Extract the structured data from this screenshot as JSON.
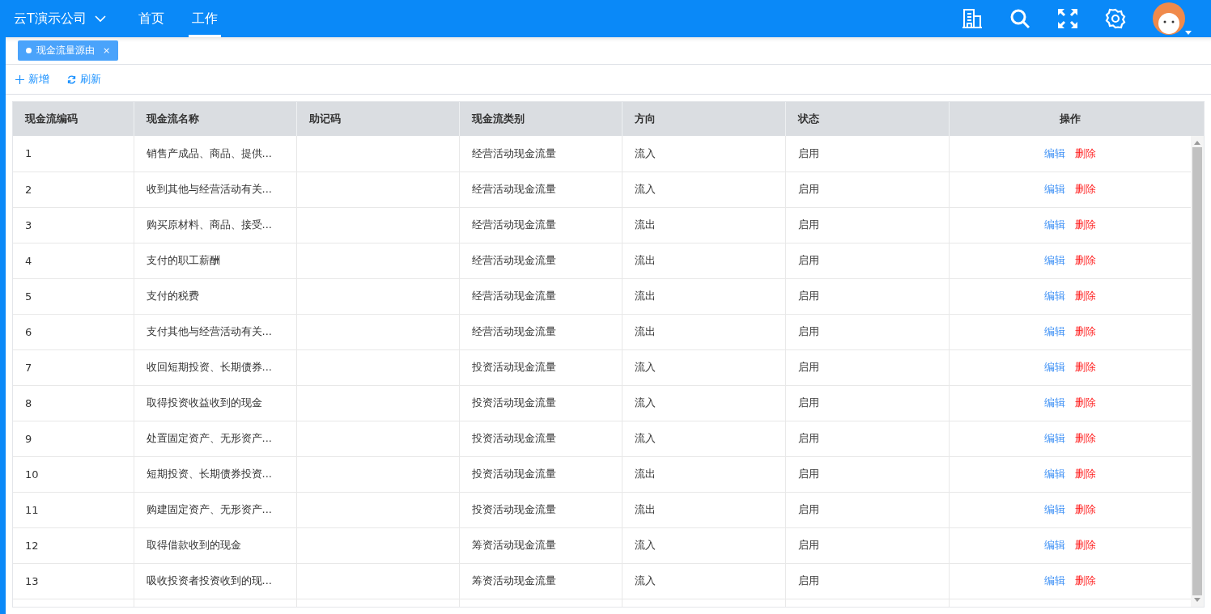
{
  "header": {
    "company": "云T演示公司",
    "nav": [
      {
        "label": "首页",
        "selected": false
      },
      {
        "label": "工作",
        "selected": true
      }
    ]
  },
  "page_tabs": [
    {
      "label": "现金流量源由",
      "selected": true,
      "close": "×"
    }
  ],
  "toolbar": [
    {
      "kind": "add",
      "label": "新增"
    },
    {
      "kind": "refresh",
      "label": "刷新"
    }
  ],
  "table": {
    "columns": [
      "现金流编码",
      "现金流名称",
      "助记码",
      "现金流类别",
      "方向",
      "状态",
      "操作"
    ],
    "rows": [
      {
        "code": "1",
        "name": "销售产成品、商品、提供...",
        "mnemonic": "",
        "category": "经营活动现金流量",
        "direction": "流入",
        "status": "启用",
        "actions": [
          "编辑",
          "删除"
        ]
      },
      {
        "code": "2",
        "name": "收到其他与经营活动有关...",
        "mnemonic": "",
        "category": "经营活动现金流量",
        "direction": "流入",
        "status": "启用",
        "actions": [
          "编辑",
          "删除"
        ]
      },
      {
        "code": "3",
        "name": "购买原材料、商品、接受...",
        "mnemonic": "",
        "category": "经营活动现金流量",
        "direction": "流出",
        "status": "启用",
        "actions": [
          "编辑",
          "删除"
        ]
      },
      {
        "code": "4",
        "name": "支付的职工薪酬",
        "mnemonic": "",
        "category": "经营活动现金流量",
        "direction": "流出",
        "status": "启用",
        "actions": [
          "编辑",
          "删除"
        ]
      },
      {
        "code": "5",
        "name": "支付的税费",
        "mnemonic": "",
        "category": "经营活动现金流量",
        "direction": "流出",
        "status": "启用",
        "actions": [
          "编辑",
          "删除"
        ]
      },
      {
        "code": "6",
        "name": "支付其他与经营活动有关...",
        "mnemonic": "",
        "category": "经营活动现金流量",
        "direction": "流出",
        "status": "启用",
        "actions": [
          "编辑",
          "删除"
        ]
      },
      {
        "code": "7",
        "name": "收回短期投资、长期债券...",
        "mnemonic": "",
        "category": "投资活动现金流量",
        "direction": "流入",
        "status": "启用",
        "actions": [
          "编辑",
          "删除"
        ]
      },
      {
        "code": "8",
        "name": "取得投资收益收到的现金",
        "mnemonic": "",
        "category": "投资活动现金流量",
        "direction": "流入",
        "status": "启用",
        "actions": [
          "编辑",
          "删除"
        ]
      },
      {
        "code": "9",
        "name": "处置固定资产、无形资产...",
        "mnemonic": "",
        "category": "投资活动现金流量",
        "direction": "流入",
        "status": "启用",
        "actions": [
          "编辑",
          "删除"
        ]
      },
      {
        "code": "10",
        "name": "短期投资、长期债券投资...",
        "mnemonic": "",
        "category": "投资活动现金流量",
        "direction": "流出",
        "status": "启用",
        "actions": [
          "编辑",
          "删除"
        ]
      },
      {
        "code": "11",
        "name": "购建固定资产、无形资产...",
        "mnemonic": "",
        "category": "投资活动现金流量",
        "direction": "流出",
        "status": "启用",
        "actions": [
          "编辑",
          "删除"
        ]
      },
      {
        "code": "12",
        "name": "取得借款收到的现金",
        "mnemonic": "",
        "category": "筹资活动现金流量",
        "direction": "流入",
        "status": "启用",
        "actions": [
          "编辑",
          "删除"
        ]
      },
      {
        "code": "13",
        "name": "吸收投资者投资收到的现...",
        "mnemonic": "",
        "category": "筹资活动现金流量",
        "direction": "流入",
        "status": "启用",
        "actions": [
          "编辑",
          "删除"
        ]
      }
    ]
  }
}
